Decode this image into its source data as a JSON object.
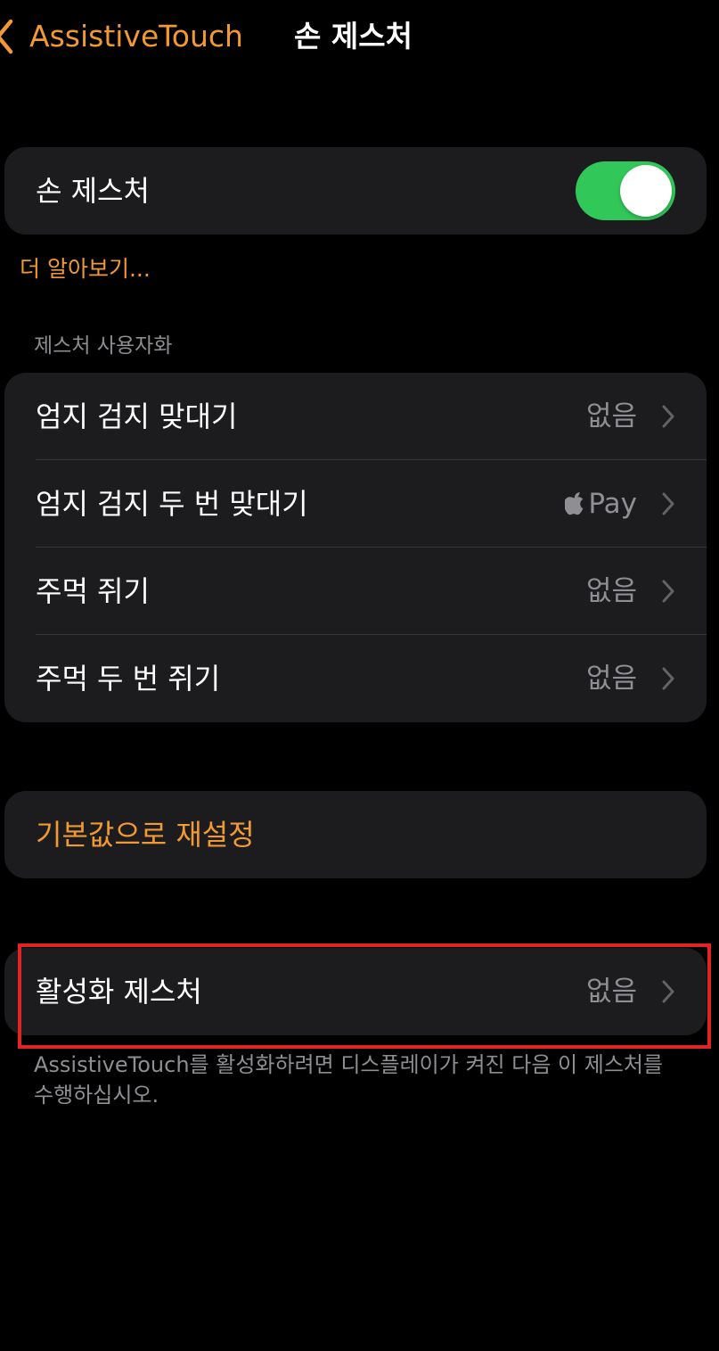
{
  "nav": {
    "back_label": "AssistiveTouch",
    "title": "손 제스처"
  },
  "main_toggle": {
    "label": "손 제스처",
    "state": "on"
  },
  "learn_more": "더 알아보기...",
  "customize_section": {
    "header": "제스처 사용자화",
    "items": [
      {
        "label": "엄지 검지 맞대기",
        "value": "없음"
      },
      {
        "label": "엄지 검지 두 번 맞대기",
        "value": "Pay"
      },
      {
        "label": "주먹 쥐기",
        "value": "없음"
      },
      {
        "label": "주먹 두 번 쥐기",
        "value": "없음"
      }
    ]
  },
  "reset": {
    "label": "기본값으로 재설정"
  },
  "activation": {
    "label": "활성화 제스처",
    "value": "없음",
    "footer": "AssistiveTouch를 활성화하려면 디스플레이가 켜진 다음 이 제스처를 수행하십시오."
  },
  "colors": {
    "accent": "#f19a34",
    "toggle_on": "#32c759",
    "cell_background": "#1c1c1e",
    "secondary_text": "#8e8e93",
    "highlight_border": "#e02424"
  },
  "icons": {
    "back": "chevron-left-icon",
    "disclosure": "chevron-right-icon",
    "apple_pay": "apple-logo-icon"
  }
}
